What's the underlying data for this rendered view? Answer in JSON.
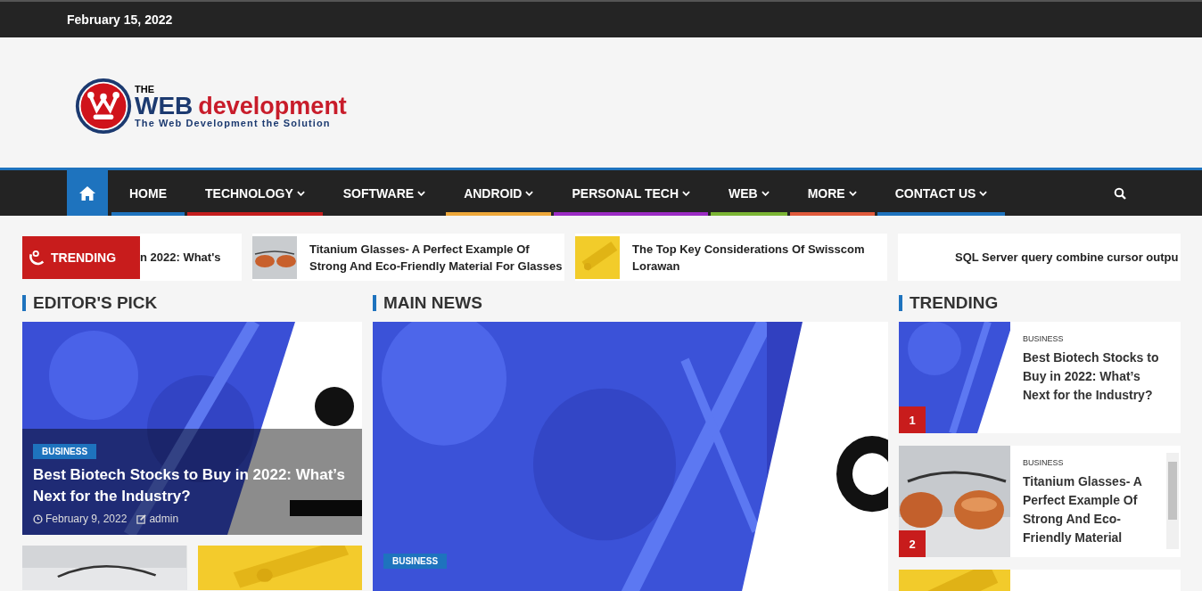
{
  "top_bar": {
    "date": "February 15, 2022"
  },
  "logo": {
    "the": "THE",
    "web": "WEB",
    "development": "development",
    "tagline": "The Web Development the Solution"
  },
  "nav": {
    "items": [
      {
        "label": "HOME",
        "has_dropdown": false,
        "color": "#1e73be"
      },
      {
        "label": "TECHNOLOGY",
        "has_dropdown": true,
        "color": "#c51d1d"
      },
      {
        "label": "SOFTWARE",
        "has_dropdown": true
      },
      {
        "label": "ANDROID",
        "has_dropdown": true,
        "color": "#eea83a"
      },
      {
        "label": "PERSONAL TECH",
        "has_dropdown": true,
        "color": "#9b2bc4"
      },
      {
        "label": "WEB",
        "has_dropdown": true,
        "color": "#7bb534"
      },
      {
        "label": "MORE",
        "has_dropdown": true,
        "color": "#e05a3c"
      },
      {
        "label": "CONTACT US",
        "has_dropdown": true,
        "color": "#1e73be"
      }
    ]
  },
  "ticker": {
    "badge": "TRENDING",
    "items": [
      {
        "title": "n 2022: What's"
      },
      {
        "title": "Titanium Glasses- A Perfect Example Of Strong And Eco-Friendly Material For Glasses",
        "thumbnail": {
          "kind": "picture"
        }
      },
      {
        "title": "The Top Key Considerations Of Swisscom Lorawan",
        "thumbnail": {
          "kind": "picture"
        }
      },
      {
        "title": "SQL Server query combine cursor outpu"
      }
    ]
  },
  "editors_pick": {
    "heading": "EDITOR'S PICK",
    "feature": {
      "category": "BUSINESS",
      "title": "Best Biotech Stocks to Buy in 2022: What’s Next for the Industry?",
      "date": "February 9, 2022",
      "author": "admin"
    },
    "more": [
      {
        "kind": "picture"
      },
      {
        "kind": "picture"
      }
    ]
  },
  "main_news": {
    "heading": "MAIN NEWS",
    "feature": {
      "category": "BUSINESS"
    }
  },
  "trending": {
    "heading": "TRENDING",
    "items": [
      {
        "rank": "1",
        "category": "BUSINESS",
        "title": "Best Biotech Stocks to Buy in 2022: What’s Next for the Industry?",
        "thumbnail": {
          "kind": "picture"
        }
      },
      {
        "rank": "2",
        "category": "BUSINESS",
        "title": "Titanium Glasses- A Perfect Example Of Strong And Eco-Friendly Material",
        "thumbnail": {
          "kind": "picture"
        }
      },
      {
        "thumbnail": {
          "kind": "picture"
        }
      }
    ]
  }
}
